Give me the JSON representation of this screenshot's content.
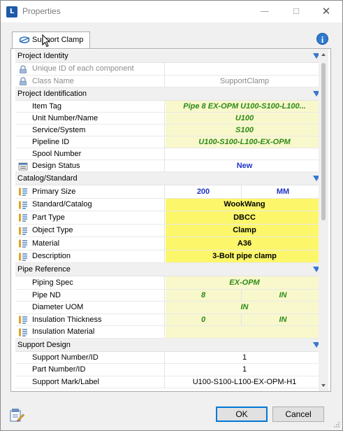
{
  "window": {
    "title": "Properties",
    "app_icon_text": "L"
  },
  "tab": {
    "label": "Support Clamp"
  },
  "sections": [
    {
      "label": "Project Identity",
      "rows": [
        {
          "label": "Unique ID of each component",
          "icon": "lock",
          "disabled": true,
          "value": "",
          "bg": "white",
          "style": "gray"
        },
        {
          "label": "Class Name",
          "icon": "lock",
          "disabled": true,
          "value": "SupportClamp",
          "bg": "white",
          "style": "gray"
        }
      ]
    },
    {
      "label": "Project Identification",
      "rows": [
        {
          "label": "Item Tag",
          "icon": "",
          "value": "Pipe 8 EX-OPM U100-S100-L100...",
          "bg": "lightyellow",
          "style": "green"
        },
        {
          "label": "Unit Number/Name",
          "icon": "",
          "value": "U100",
          "bg": "lightyellow",
          "style": "green"
        },
        {
          "label": "Service/System",
          "icon": "",
          "value": "S100",
          "bg": "lightyellow",
          "style": "green"
        },
        {
          "label": "Pipeline ID",
          "icon": "",
          "value": "U100-S100-L100-EX-OPM",
          "bg": "lightyellow",
          "style": "green"
        },
        {
          "label": "Spool Number",
          "icon": "",
          "value": "",
          "bg": "white",
          "style": "plain"
        },
        {
          "label": "Design Status",
          "icon": "list",
          "value": "New",
          "bg": "white",
          "style": "blue"
        }
      ]
    },
    {
      "label": "Catalog/Standard",
      "rows": [
        {
          "label": "Primary Size",
          "icon": "catalog",
          "value": "200",
          "unit": "MM",
          "bg": "white",
          "style": "blue"
        },
        {
          "label": "Standard/Catalog",
          "icon": "catalog",
          "value": "WookWang",
          "bg": "yellow",
          "style": "black-bold"
        },
        {
          "label": "Part Type",
          "icon": "catalog",
          "value": "DBCC",
          "bg": "yellow",
          "style": "black-bold"
        },
        {
          "label": "Object Type",
          "icon": "catalog",
          "value": "Clamp",
          "bg": "yellow",
          "style": "black-bold"
        },
        {
          "label": "Material",
          "icon": "catalog",
          "value": "A36",
          "bg": "yellow",
          "style": "black-bold"
        },
        {
          "label": "Description",
          "icon": "catalog",
          "value": "3-Bolt pipe clamp",
          "bg": "yellow",
          "style": "black-bold"
        }
      ]
    },
    {
      "label": "Pipe Reference",
      "rows": [
        {
          "label": "Piping Spec",
          "icon": "",
          "value": "EX-OPM",
          "bg": "lightyellow",
          "style": "green"
        },
        {
          "label": "Pipe ND",
          "icon": "",
          "value": "8",
          "unit": "IN",
          "bg": "lightyellow",
          "style": "green"
        },
        {
          "label": "Diameter UOM",
          "icon": "",
          "value": "IN",
          "bg": "lightyellow",
          "style": "green"
        },
        {
          "label": "Insulation Thickness",
          "icon": "catalog",
          "value": "0",
          "unit": "IN",
          "bg": "lightyellow",
          "style": "green"
        },
        {
          "label": "Insulation Material",
          "icon": "catalog",
          "value": "",
          "bg": "lightyellow",
          "style": "green"
        }
      ]
    },
    {
      "label": "Support Design",
      "rows": [
        {
          "label": "Support Number/ID",
          "icon": "",
          "value": "1",
          "bg": "white",
          "style": "plain"
        },
        {
          "label": "Part Number/ID",
          "icon": "",
          "value": "1",
          "bg": "white",
          "style": "plain"
        },
        {
          "label": "Support Mark/Label",
          "icon": "",
          "value": "U100-S100-L100-EX-OPM-H1",
          "bg": "white",
          "style": "plain"
        }
      ]
    }
  ],
  "buttons": {
    "ok": "OK",
    "cancel": "Cancel"
  },
  "colors": {
    "green_text": "#2c8a16",
    "blue_text": "#1f33c6",
    "yellow_bg": "#fcf76a",
    "lightyellow_bg": "#f8f8cc",
    "accent": "#0078d7"
  }
}
